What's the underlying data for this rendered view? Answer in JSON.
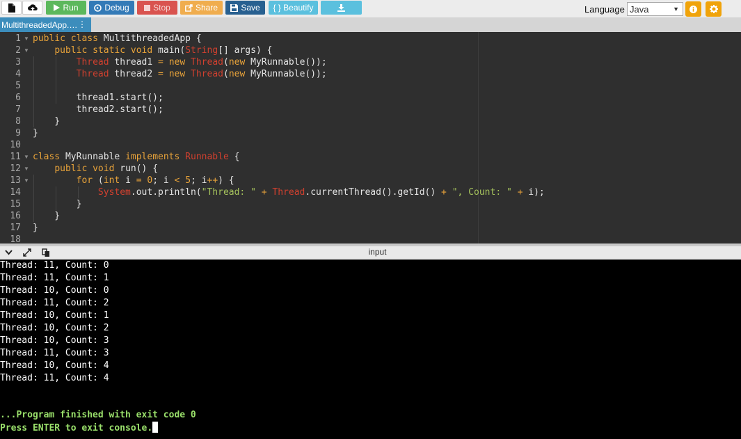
{
  "toolbar": {
    "run_label": "Run",
    "debug_label": "Debug",
    "stop_label": "Stop",
    "share_label": "Share",
    "save_label": "Save",
    "beautify_label": "{ } Beautify",
    "language_label": "Language",
    "language_value": "Java",
    "colors": {
      "run": "#5cb85c",
      "debug": "#337ab7",
      "stop": "#d9534f",
      "share": "#f0ad4e",
      "save": "#286090",
      "beautify": "#5bc0de",
      "download": "#5bc0de",
      "round": "#f0a30a"
    },
    "icons": [
      "new-file-icon",
      "upload-icon",
      "play-icon",
      "debug-icon",
      "stop-icon",
      "share-icon",
      "save-icon",
      "download-icon",
      "info-icon",
      "gear-icon"
    ]
  },
  "tab": {
    "filename": "MultithreadedApp.java"
  },
  "editor": {
    "line_numbers": [
      "1",
      "2",
      "3",
      "4",
      "5",
      "6",
      "7",
      "8",
      "9",
      "10",
      "11",
      "12",
      "13",
      "14",
      "15",
      "16",
      "17",
      "18"
    ]
  },
  "io_panel": {
    "title": "input",
    "icons": [
      "collapse-icon",
      "expand-icon",
      "copy-icon"
    ]
  },
  "console": {
    "output": [
      "Thread: 11, Count: 0",
      "Thread: 11, Count: 1",
      "Thread: 10, Count: 0",
      "Thread: 11, Count: 2",
      "Thread: 10, Count: 1",
      "Thread: 10, Count: 2",
      "Thread: 10, Count: 3",
      "Thread: 11, Count: 3",
      "Thread: 10, Count: 4",
      "Thread: 11, Count: 4"
    ],
    "finished": "...Program finished with exit code 0",
    "prompt": "Press ENTER to exit console."
  }
}
